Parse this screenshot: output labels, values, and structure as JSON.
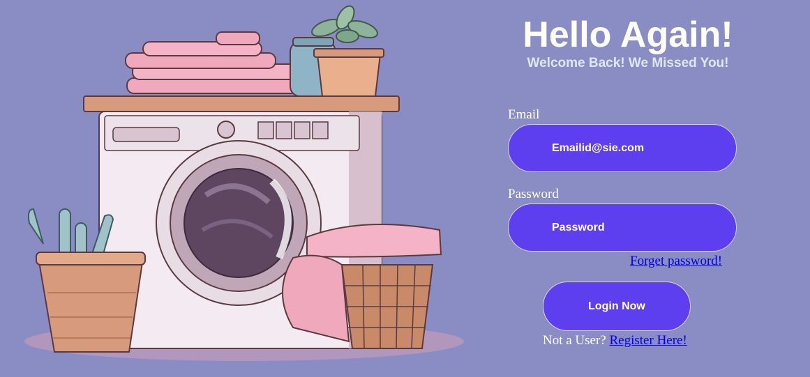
{
  "header": {
    "title": "Hello Again!",
    "subtitle": "Welcome Back! We Missed You!"
  },
  "form": {
    "email_label": "Email",
    "email_value": "Emailid@sie.com",
    "password_label": "Password",
    "password_value": "Password",
    "forgot_link": "Forget password!",
    "login_button": "Login Now",
    "register_prompt": "Not a User?",
    "register_link": "Register Here!"
  },
  "illustration": {
    "icon": "washing-machine-illustration"
  },
  "colors": {
    "background": "#8a8cc4",
    "accent": "#5e3fef",
    "title": "#ffffff",
    "subtitle": "#dde5ff",
    "link": "#0000ee"
  }
}
